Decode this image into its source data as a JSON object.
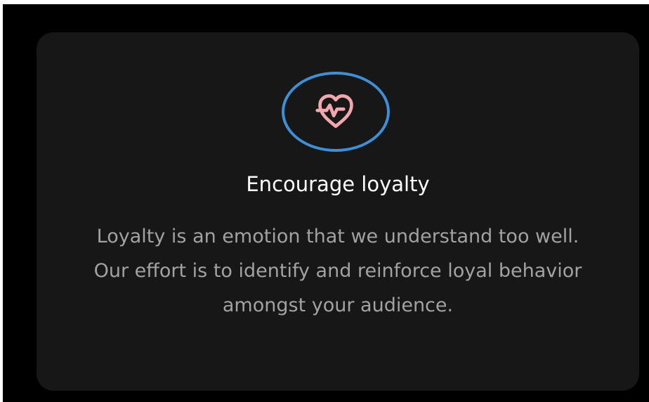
{
  "card": {
    "title": "Encourage loyalty",
    "description": "Loyalty is an emotion that we understand too well. Our effort is to identify and reinforce loyal behavior amongst your audience.",
    "icon": "heart-pulse-icon"
  },
  "colors": {
    "outer_background": "#000000",
    "card_background": "#171717",
    "icon_ring": "#3f8fd6",
    "icon_fill": "#f2a6ad",
    "title_text": "#ffffff",
    "body_text": "#a2a2a2"
  }
}
